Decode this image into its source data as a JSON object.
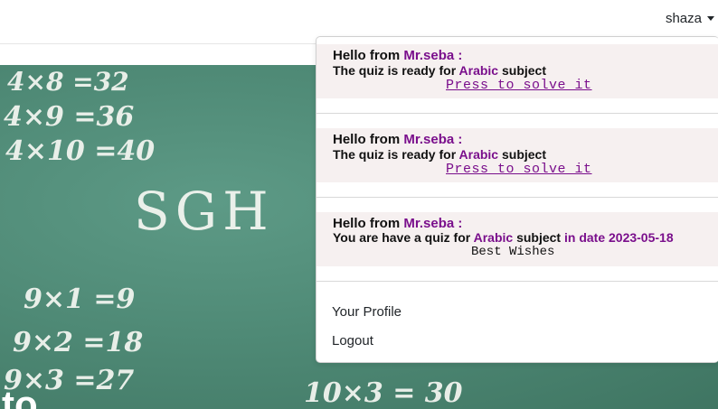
{
  "navbar": {
    "user_name": "shaza"
  },
  "hero": {
    "chalk_lines": [
      "4×8 =32",
      "4×9 =36",
      "4×10 =40",
      "SGH",
      "9×1 =9",
      "9×2 =18",
      "9×3 =27",
      "10×3 = 30"
    ],
    "heading_fragment": "to"
  },
  "notifications": [
    {
      "greeting": "Hello from",
      "sender": "Mr.seba :",
      "message_prefix": "The quiz is ready for",
      "subject": "Arabic",
      "message_suffix": "subject",
      "action_link": "Press to solve it"
    },
    {
      "greeting": "Hello from",
      "sender": "Mr.seba :",
      "message_prefix": "The quiz is ready for",
      "subject": "Arabic",
      "message_suffix": "subject",
      "action_link": "Press to solve it"
    },
    {
      "greeting": "Hello from",
      "sender": "Mr.seba :",
      "message_prefix": "You are have a quiz for",
      "subject": "Arabic",
      "message_suffix": "subject",
      "date_label": "in date 2023-05-18",
      "closing": "Best Wishes"
    }
  ],
  "menu": {
    "profile": "Your Profile",
    "logout": "Logout"
  },
  "colors": {
    "accent_purple": "#7a0f8c",
    "chalkboard": "#4f8a76",
    "notification_bg": "#f6f0f0"
  }
}
